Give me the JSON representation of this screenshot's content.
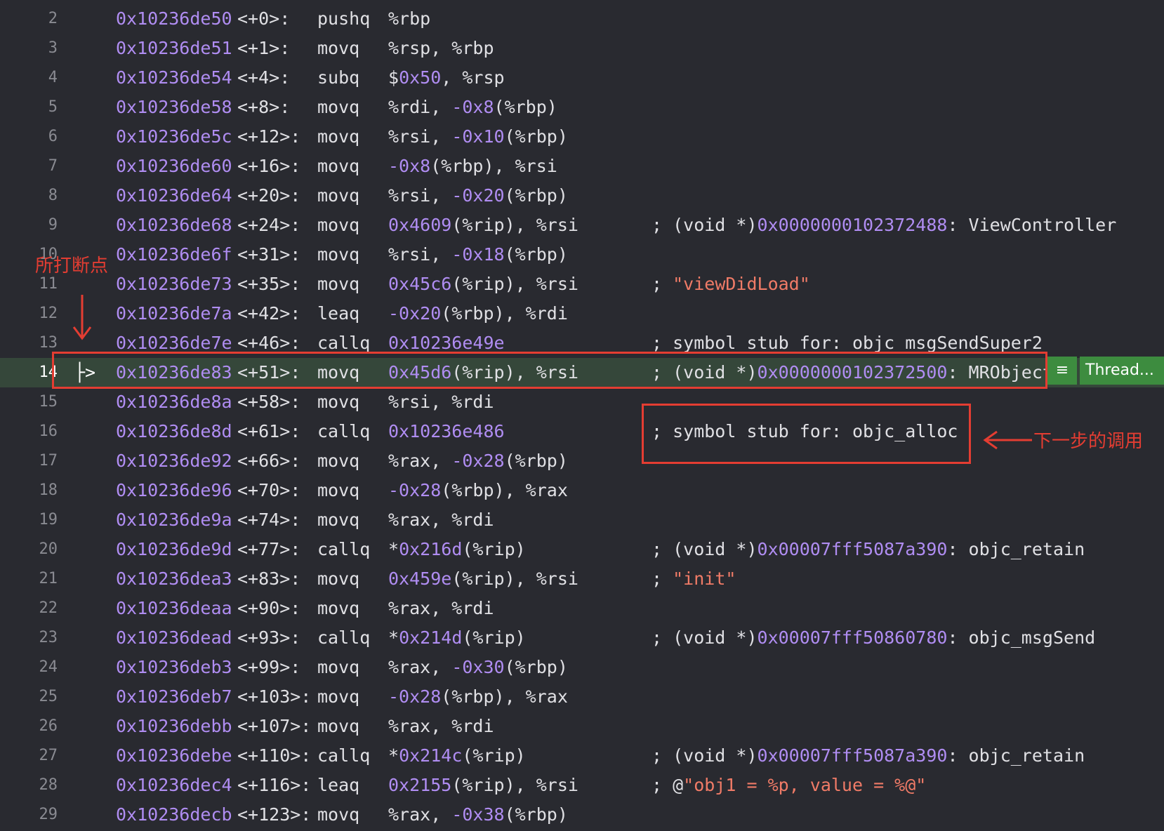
{
  "disassembly": [
    {
      "line": "2",
      "addr": "0x10236de50",
      "offset": "<+0>:",
      "mnemonic": "pushq",
      "ops": [
        [
          "%rbp",
          "p"
        ]
      ],
      "comment": []
    },
    {
      "line": "3",
      "addr": "0x10236de51",
      "offset": "<+1>:",
      "mnemonic": "movq",
      "ops": [
        [
          "%rsp, %rbp",
          "p"
        ]
      ],
      "comment": []
    },
    {
      "line": "4",
      "addr": "0x10236de54",
      "offset": "<+4>:",
      "mnemonic": "subq",
      "ops": [
        [
          "$",
          "p"
        ],
        [
          "0x50",
          "n"
        ],
        [
          ", %rsp",
          "p"
        ]
      ],
      "comment": []
    },
    {
      "line": "5",
      "addr": "0x10236de58",
      "offset": "<+8>:",
      "mnemonic": "movq",
      "ops": [
        [
          "%rdi, ",
          "p"
        ],
        [
          "-0x8",
          "n"
        ],
        [
          "(%rbp)",
          "p"
        ]
      ],
      "comment": []
    },
    {
      "line": "6",
      "addr": "0x10236de5c",
      "offset": "<+12>:",
      "mnemonic": "movq",
      "ops": [
        [
          "%rsi, ",
          "p"
        ],
        [
          "-0x10",
          "n"
        ],
        [
          "(%rbp)",
          "p"
        ]
      ],
      "comment": []
    },
    {
      "line": "7",
      "addr": "0x10236de60",
      "offset": "<+16>:",
      "mnemonic": "movq",
      "ops": [
        [
          "-0x8",
          "n"
        ],
        [
          "(%rbp), %rsi",
          "p"
        ]
      ],
      "comment": []
    },
    {
      "line": "8",
      "addr": "0x10236de64",
      "offset": "<+20>:",
      "mnemonic": "movq",
      "ops": [
        [
          "%rsi, ",
          "p"
        ],
        [
          "-0x20",
          "n"
        ],
        [
          "(%rbp)",
          "p"
        ]
      ],
      "comment": []
    },
    {
      "line": "9",
      "addr": "0x10236de68",
      "offset": "<+24>:",
      "mnemonic": "movq",
      "ops": [
        [
          "0x4609",
          "n"
        ],
        [
          "(%rip), %rsi",
          "p"
        ]
      ],
      "comment": [
        [
          "; (void *)",
          "p"
        ],
        [
          "0x0000000102372488",
          "n"
        ],
        [
          ": ViewController",
          "p"
        ]
      ]
    },
    {
      "line": "10",
      "addr": "0x10236de6f",
      "offset": "<+31>:",
      "mnemonic": "movq",
      "ops": [
        [
          "%rsi, ",
          "p"
        ],
        [
          "-0x18",
          "n"
        ],
        [
          "(%rbp)",
          "p"
        ]
      ],
      "comment": []
    },
    {
      "line": "11",
      "addr": "0x10236de73",
      "offset": "<+35>:",
      "mnemonic": "movq",
      "ops": [
        [
          "0x45c6",
          "n"
        ],
        [
          "(%rip), %rsi",
          "p"
        ]
      ],
      "comment": [
        [
          "; ",
          "p"
        ],
        [
          "\"viewDidLoad\"",
          "s"
        ]
      ]
    },
    {
      "line": "12",
      "addr": "0x10236de7a",
      "offset": "<+42>:",
      "mnemonic": "leaq",
      "ops": [
        [
          "-0x20",
          "n"
        ],
        [
          "(%rbp), %rdi",
          "p"
        ]
      ],
      "comment": []
    },
    {
      "line": "13",
      "addr": "0x10236de7e",
      "offset": "<+46>:",
      "mnemonic": "callq",
      "ops": [
        [
          "0x10236e49e",
          "n"
        ]
      ],
      "comment": [
        [
          "; symbol stub for: objc_msgSendSuper2",
          "p"
        ]
      ]
    },
    {
      "line": "14",
      "addr": "0x10236de83",
      "offset": "<+51>:",
      "mnemonic": "movq",
      "ops": [
        [
          "0x45d6",
          "n"
        ],
        [
          "(%rip), %rsi",
          "p"
        ]
      ],
      "comment": [
        [
          "; (void *)",
          "p"
        ],
        [
          "0x0000000102372500",
          "n"
        ],
        [
          ": MRObject",
          "p"
        ]
      ],
      "current": true
    },
    {
      "line": "15",
      "addr": "0x10236de8a",
      "offset": "<+58>:",
      "mnemonic": "movq",
      "ops": [
        [
          "%rsi, %rdi",
          "p"
        ]
      ],
      "comment": []
    },
    {
      "line": "16",
      "addr": "0x10236de8d",
      "offset": "<+61>:",
      "mnemonic": "callq",
      "ops": [
        [
          "0x10236e486",
          "n"
        ]
      ],
      "comment": [
        [
          "; symbol stub for: objc_alloc",
          "p"
        ]
      ]
    },
    {
      "line": "17",
      "addr": "0x10236de92",
      "offset": "<+66>:",
      "mnemonic": "movq",
      "ops": [
        [
          "%rax, ",
          "p"
        ],
        [
          "-0x28",
          "n"
        ],
        [
          "(%rbp)",
          "p"
        ]
      ],
      "comment": []
    },
    {
      "line": "18",
      "addr": "0x10236de96",
      "offset": "<+70>:",
      "mnemonic": "movq",
      "ops": [
        [
          "-0x28",
          "n"
        ],
        [
          "(%rbp), %rax",
          "p"
        ]
      ],
      "comment": []
    },
    {
      "line": "19",
      "addr": "0x10236de9a",
      "offset": "<+74>:",
      "mnemonic": "movq",
      "ops": [
        [
          "%rax, %rdi",
          "p"
        ]
      ],
      "comment": []
    },
    {
      "line": "20",
      "addr": "0x10236de9d",
      "offset": "<+77>:",
      "mnemonic": "callq",
      "ops": [
        [
          "*",
          "p"
        ],
        [
          "0x216d",
          "n"
        ],
        [
          "(%rip)",
          "p"
        ]
      ],
      "comment": [
        [
          "; (void *)",
          "p"
        ],
        [
          "0x00007fff5087a390",
          "n"
        ],
        [
          ": objc_retain",
          "p"
        ]
      ]
    },
    {
      "line": "21",
      "addr": "0x10236dea3",
      "offset": "<+83>:",
      "mnemonic": "movq",
      "ops": [
        [
          "0x459e",
          "n"
        ],
        [
          "(%rip), %rsi",
          "p"
        ]
      ],
      "comment": [
        [
          "; ",
          "p"
        ],
        [
          "\"init\"",
          "s"
        ]
      ]
    },
    {
      "line": "22",
      "addr": "0x10236deaa",
      "offset": "<+90>:",
      "mnemonic": "movq",
      "ops": [
        [
          "%rax, %rdi",
          "p"
        ]
      ],
      "comment": []
    },
    {
      "line": "23",
      "addr": "0x10236dead",
      "offset": "<+93>:",
      "mnemonic": "callq",
      "ops": [
        [
          "*",
          "p"
        ],
        [
          "0x214d",
          "n"
        ],
        [
          "(%rip)",
          "p"
        ]
      ],
      "comment": [
        [
          "; (void *)",
          "p"
        ],
        [
          "0x00007fff50860780",
          "n"
        ],
        [
          ": objc_msgSend",
          "p"
        ]
      ]
    },
    {
      "line": "24",
      "addr": "0x10236deb3",
      "offset": "<+99>:",
      "mnemonic": "movq",
      "ops": [
        [
          "%rax, ",
          "p"
        ],
        [
          "-0x30",
          "n"
        ],
        [
          "(%rbp)",
          "p"
        ]
      ],
      "comment": []
    },
    {
      "line": "25",
      "addr": "0x10236deb7",
      "offset": "<+103>:",
      "mnemonic": "movq",
      "ops": [
        [
          "-0x28",
          "n"
        ],
        [
          "(%rbp), %rax",
          "p"
        ]
      ],
      "comment": []
    },
    {
      "line": "26",
      "addr": "0x10236debb",
      "offset": "<+107>:",
      "mnemonic": "movq",
      "ops": [
        [
          "%rax, %rdi",
          "p"
        ]
      ],
      "comment": []
    },
    {
      "line": "27",
      "addr": "0x10236debe",
      "offset": "<+110>:",
      "mnemonic": "callq",
      "ops": [
        [
          "*",
          "p"
        ],
        [
          "0x214c",
          "n"
        ],
        [
          "(%rip)",
          "p"
        ]
      ],
      "comment": [
        [
          "; (void *)",
          "p"
        ],
        [
          "0x00007fff5087a390",
          "n"
        ],
        [
          ": objc_retain",
          "p"
        ]
      ]
    },
    {
      "line": "28",
      "addr": "0x10236dec4",
      "offset": "<+116>:",
      "mnemonic": "leaq",
      "ops": [
        [
          "0x2155",
          "n"
        ],
        [
          "(%rip), %rsi",
          "p"
        ]
      ],
      "comment": [
        [
          "; @",
          "p"
        ],
        [
          "\"obj1 = %p, value = %@\"",
          "s"
        ]
      ]
    },
    {
      "line": "29",
      "addr": "0x10236decb",
      "offset": "<+123>:",
      "mnemonic": "movq",
      "ops": [
        [
          "%rax, ",
          "p"
        ],
        [
          "-0x38",
          "n"
        ],
        [
          "(%rbp)",
          "p"
        ]
      ],
      "comment": []
    }
  ],
  "current_line_marker": "├>",
  "thread_badge": {
    "menu_glyph": "≡",
    "label": "Thread..."
  },
  "annotations": {
    "breakpoint_label": "所打断点",
    "next_call_label": "下一步的调用"
  },
  "colors": {
    "background": "#292a30",
    "current_line": "#35473a",
    "number": "#b08df2",
    "string": "#f07b67",
    "annotation_red": "#e43d32",
    "badge_green": "#3d8c3f"
  }
}
